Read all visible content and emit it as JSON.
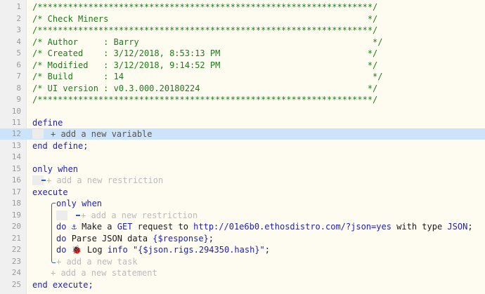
{
  "line_numbers": [
    "1",
    "2",
    "3",
    "4",
    "5",
    "6",
    "7",
    "8",
    "9",
    "10",
    "11",
    "12",
    "13",
    "14",
    "15",
    "16",
    "17",
    "18",
    "19",
    "20",
    "21",
    "22",
    "23",
    "24",
    "25"
  ],
  "header": {
    "border": "/******************************************************************/",
    "title": "/* Check Miners                                                   */",
    "author": "/* Author     : Barry                                              */",
    "created": "/* Created    : 3/12/2018, 8:53:13 PM                             */",
    "modified": "/* Modified   : 3/12/2018, 9:14:52 PM                             */",
    "build": "/* Build      : 14                                                 */",
    "ui_version": "/* UI version : v0.3.000.20180224                                 */"
  },
  "code": {
    "define": "define",
    "add_variable": "+ add a new variable",
    "end_define": "end define;",
    "only_when": "only when",
    "add_restriction": "+ add a new restriction",
    "execute": "execute",
    "inner_only_when": "only when",
    "do": "do",
    "anchor_icon": "⚓",
    "make_a": "Make a",
    "get": "GET",
    "request_to": "request to",
    "url": "http://01e6b0.ethosdistro.com/?json=yes",
    "with_type": "with type",
    "json": "JSON",
    "parse_json_data": "Parse JSON data",
    "response_var": "{$response}",
    "semicolon": ";",
    "bug_icon": "🐞",
    "log": "Log",
    "info": "info",
    "log_string": "\"{$json.rigs.294350.hash}\"",
    "add_task": "+ add a new task",
    "add_statement": "+ add a new statement",
    "end_execute": "end execute;"
  },
  "colors": {
    "comment": "#1f7a1f",
    "keyword": "#1d1dbf",
    "active_line": "#cde3fa",
    "background": "#fefcf0"
  }
}
